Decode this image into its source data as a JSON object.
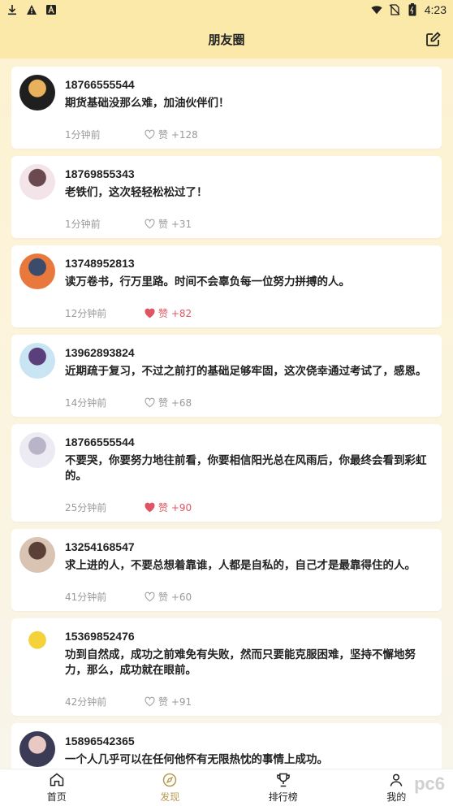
{
  "status_bar": {
    "time": "4:23"
  },
  "header": {
    "title": "朋友圈"
  },
  "posts": [
    {
      "user": "18766555544",
      "text": "期货基础没那么难，加油伙伴们！",
      "time": "1分钟前",
      "like_label": "赞 +128",
      "liked": false,
      "avatar_colors": [
        "#1f1f1f",
        "#e9b15b"
      ]
    },
    {
      "user": "18769855343",
      "text": "老铁们，这次轻轻松松过了！",
      "time": "1分钟前",
      "like_label": "赞 +31",
      "liked": false,
      "avatar_colors": [
        "#f3e4ea",
        "#6b4a4f"
      ]
    },
    {
      "user": "13748952813",
      "text": "读万卷书，行万里路。时间不会辜负每一位努力拼搏的人。",
      "time": "12分钟前",
      "like_label": "赞 +82",
      "liked": true,
      "avatar_colors": [
        "#e8783b",
        "#3b4b6b"
      ]
    },
    {
      "user": "13962893824",
      "text": "近期疏于复习，不过之前打的基础足够牢固，这次侥幸通过考试了，感恩。",
      "time": "14分钟前",
      "like_label": "赞 +68",
      "liked": false,
      "avatar_colors": [
        "#c9e4f3",
        "#5a3f7a"
      ]
    },
    {
      "user": "18766555544",
      "text": "不要哭，你要努力地往前看，你要相信阳光总在风雨后，你最终会看到彩虹的。",
      "time": "25分钟前",
      "like_label": "赞 +90",
      "liked": true,
      "avatar_colors": [
        "#eceaf2",
        "#b9b4c8"
      ]
    },
    {
      "user": "13254168547",
      "text": "求上进的人，不要总想着靠谁，人都是自私的，自己才是最靠得住的人。",
      "time": "41分钟前",
      "like_label": "赞 +60",
      "liked": false,
      "avatar_colors": [
        "#d9c4b3",
        "#5b4038"
      ]
    },
    {
      "user": "15369852476",
      "text": "功到自然成，成功之前难免有失败，然而只要能克服困难，坚持不懈地努力，那么，成功就在眼前。",
      "time": "42分钟前",
      "like_label": "赞 +91",
      "liked": false,
      "avatar_colors": [
        "#ffffff",
        "#f3d23a"
      ]
    },
    {
      "user": "15896542365",
      "text": "一个人几乎可以在任何他怀有无限热忱的事情上成功。",
      "time": "",
      "like_label": "",
      "liked": false,
      "avatar_colors": [
        "#3b3b55",
        "#e9c9c4"
      ]
    }
  ],
  "tabs": [
    {
      "label": "首页",
      "icon": "home-icon",
      "active": false
    },
    {
      "label": "发现",
      "icon": "compass-icon",
      "active": true
    },
    {
      "label": "排行榜",
      "icon": "trophy-icon",
      "active": false
    },
    {
      "label": "我的",
      "icon": "user-icon",
      "active": false
    }
  ],
  "watermark": "pc6"
}
